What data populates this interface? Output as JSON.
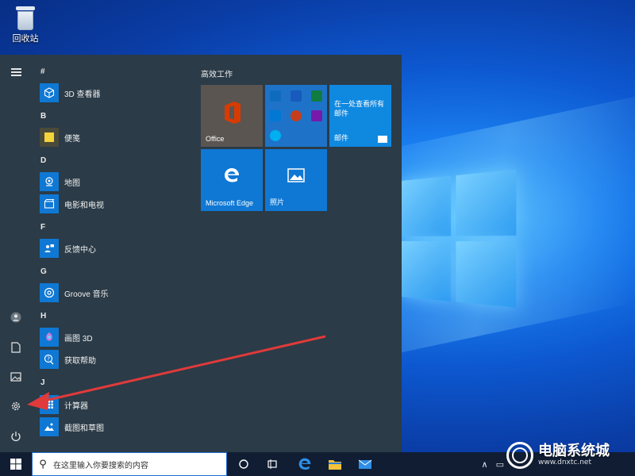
{
  "desktop": {
    "recycle_bin_label": "回收站"
  },
  "start_menu": {
    "rail_icons": [
      "menu-icon",
      "user-icon",
      "document-icon",
      "pictures-icon",
      "settings-icon",
      "power-icon"
    ],
    "letters": [
      "#",
      "B",
      "D",
      "F",
      "G",
      "H",
      "J"
    ],
    "apps": [
      {
        "name": "3D 查看器",
        "icon": "3d-viewer-icon",
        "color": "#0f78d4"
      },
      {
        "name": "便笺",
        "icon": "sticky-notes-icon",
        "color": "#4a4a3a"
      },
      {
        "name": "地图",
        "icon": "maps-icon",
        "color": "#0f78d4"
      },
      {
        "name": "电影和电视",
        "icon": "movies-tv-icon",
        "color": "#0f78d4"
      },
      {
        "name": "反馈中心",
        "icon": "feedback-hub-icon",
        "color": "#0f78d4"
      },
      {
        "name": "Groove 音乐",
        "icon": "groove-music-icon",
        "color": "#0f78d4"
      },
      {
        "name": "画图 3D",
        "icon": "paint-3d-icon",
        "color": "#0f78d4"
      },
      {
        "name": "获取帮助",
        "icon": "get-help-icon",
        "color": "#0f78d4"
      },
      {
        "name": "计算器",
        "icon": "calculator-icon",
        "color": "#0f78d4"
      },
      {
        "name": "截图和草图",
        "icon": "snip-sketch-icon",
        "color": "#0f78d4"
      }
    ],
    "tiles_group_title": "高效工作",
    "tiles": {
      "office": "Office",
      "mail_line1": "在一处查看所有",
      "mail_line2": "邮件",
      "mail_label": "邮件",
      "edge": "Microsoft Edge",
      "photos": "照片"
    }
  },
  "taskbar": {
    "search_placeholder": "在这里输入你要搜索的内容",
    "tray_chevron": "∧"
  },
  "watermark": {
    "title": "电脑系统城",
    "url": "www.dnxtc.net"
  },
  "colors": {
    "start_bg": "#2b3b47",
    "tile_blue": "#0f78d4",
    "taskbar": "#101d33",
    "arrow": "#e03a3a"
  }
}
